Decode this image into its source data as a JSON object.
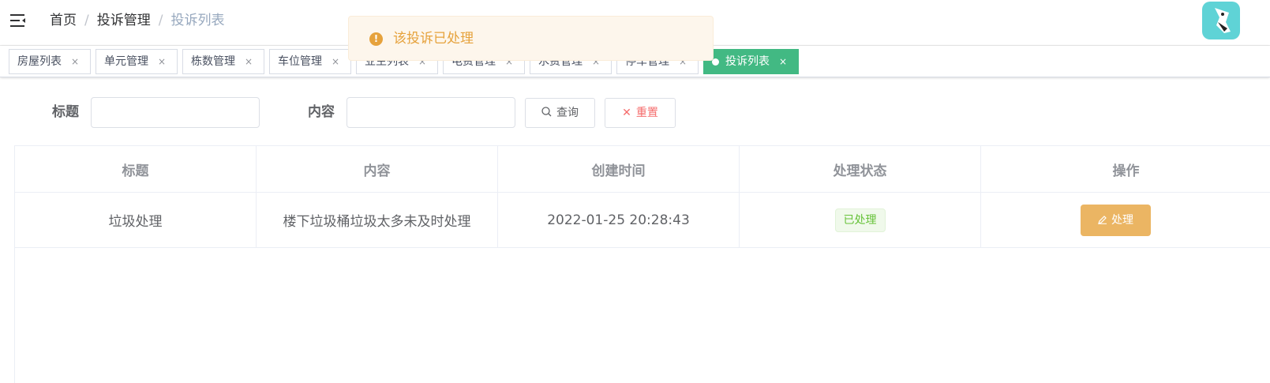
{
  "breadcrumb": {
    "items": [
      "首页",
      "投诉管理"
    ],
    "current": "投诉列表",
    "separator": "/"
  },
  "tags": [
    {
      "label": "房屋列表",
      "close": "×"
    },
    {
      "label": "单元管理",
      "close": "×"
    },
    {
      "label": "栋数管理",
      "close": "×"
    },
    {
      "label": "车位管理",
      "close": "×"
    },
    {
      "label": "业主列表",
      "close": "×"
    },
    {
      "label": "电费管理",
      "close": "×"
    },
    {
      "label": "水费管理",
      "close": "×"
    },
    {
      "label": "停车管理",
      "close": "×"
    },
    {
      "label": "投诉列表",
      "close": "×",
      "active": true
    }
  ],
  "message": {
    "text": "该投诉已处理",
    "icon": "!",
    "type": "warning"
  },
  "filters": {
    "title_label": "标题",
    "title_value": "",
    "content_label": "内容",
    "content_value": "",
    "search_button": "查询",
    "reset_button": "重置",
    "reset_icon": "✕"
  },
  "table": {
    "headers": [
      "标题",
      "内容",
      "创建时间",
      "处理状态",
      "操作"
    ],
    "rows": [
      {
        "title": "垃圾处理",
        "content": "楼下垃圾桶垃圾太多未及时处理",
        "created": "2022-01-25 20:28:43",
        "status": "已处理",
        "action": "处理"
      }
    ]
  },
  "colors": {
    "active_tag": "#42b983",
    "warning": "#e6a23c",
    "success": "#67c23a",
    "danger": "#f56c6c",
    "handle_button": "#ebb563",
    "avatar_bg": "#5fd3d6"
  },
  "icons": [
    "hamburger-icon",
    "warning-circle-icon",
    "search-icon",
    "close-icon",
    "edit-icon",
    "avatar"
  ]
}
